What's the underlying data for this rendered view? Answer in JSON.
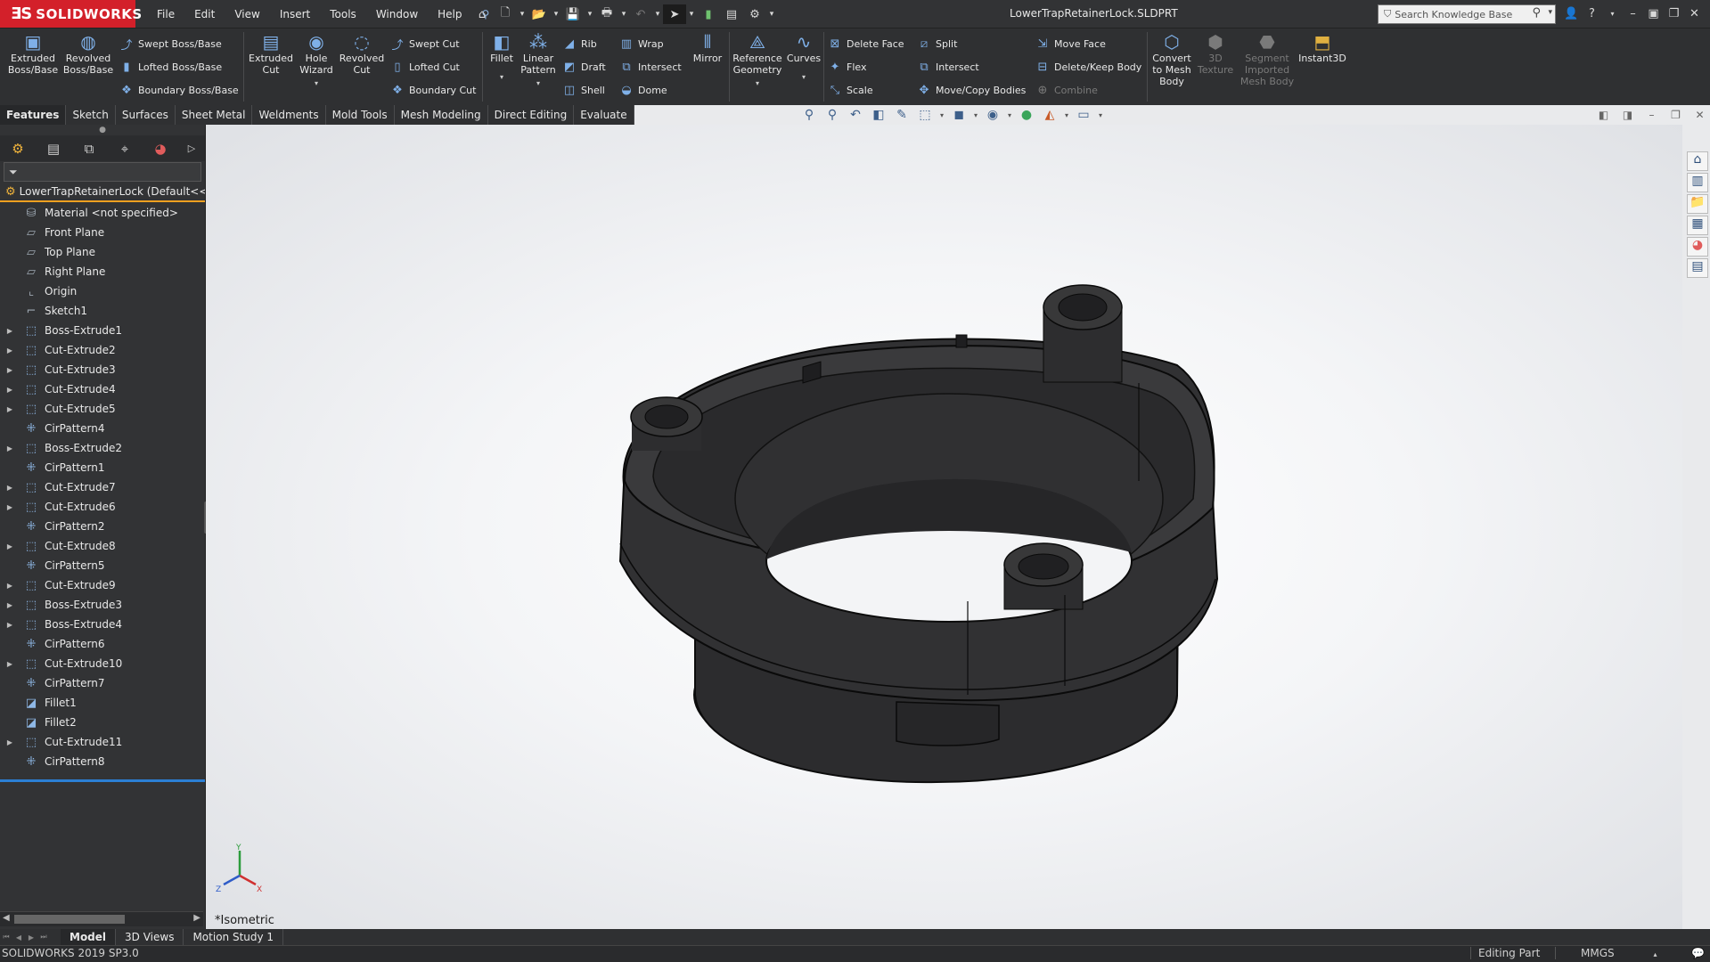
{
  "app": {
    "logo": "SOLIDWORKS",
    "document_title": "LowerTrapRetainerLock.SLDPRT"
  },
  "menus": [
    "File",
    "Edit",
    "View",
    "Insert",
    "Tools",
    "Window",
    "Help"
  ],
  "search": {
    "placeholder": "Search Knowledge Base"
  },
  "commands": {
    "extruded_boss": "Extruded\nBoss/Base",
    "revolved_boss": "Revolved\nBoss/Base",
    "swept_boss": "Swept Boss/Base",
    "lofted_boss": "Lofted Boss/Base",
    "boundary_boss": "Boundary Boss/Base",
    "extruded_cut": "Extruded\nCut",
    "hole_wizard": "Hole\nWizard",
    "revolved_cut": "Revolved\nCut",
    "swept_cut": "Swept Cut",
    "lofted_cut": "Lofted Cut",
    "boundary_cut": "Boundary Cut",
    "fillet": "Fillet",
    "linear_pattern": "Linear\nPattern",
    "rib": "Rib",
    "draft": "Draft",
    "shell": "Shell",
    "wrap": "Wrap",
    "intersect": "Intersect",
    "dome": "Dome",
    "mirror": "Mirror",
    "reference_geometry": "Reference\nGeometry",
    "curves": "Curves",
    "delete_face": "Delete Face",
    "flex": "Flex",
    "scale": "Scale",
    "split": "Split",
    "intersect2": "Intersect",
    "move_copy_bodies": "Move/Copy Bodies",
    "move_face": "Move Face",
    "delete_keep_body": "Delete/Keep Body",
    "combine": "Combine",
    "convert_mesh": "Convert\nto Mesh\nBody",
    "texture_3d": "3D\nTexture",
    "segment_mesh": "Segment\nImported\nMesh Body",
    "instant3d": "Instant3D"
  },
  "tabs": [
    "Features",
    "Sketch",
    "Surfaces",
    "Sheet Metal",
    "Weldments",
    "Mold Tools",
    "Mesh Modeling",
    "Direct Editing",
    "Evaluate"
  ],
  "tree": {
    "root": "LowerTrapRetainerLock  (Default<<De",
    "items": [
      {
        "label": "Material <not specified>",
        "expandable": false,
        "icon": "material-icon"
      },
      {
        "label": "Front Plane",
        "expandable": false,
        "icon": "plane-icon"
      },
      {
        "label": "Top Plane",
        "expandable": false,
        "icon": "plane-icon"
      },
      {
        "label": "Right Plane",
        "expandable": false,
        "icon": "plane-icon"
      },
      {
        "label": "Origin",
        "expandable": false,
        "icon": "origin-icon"
      },
      {
        "label": "Sketch1",
        "expandable": false,
        "icon": "sketch-icon"
      },
      {
        "label": "Boss-Extrude1",
        "expandable": true,
        "icon": "extrude-icon"
      },
      {
        "label": "Cut-Extrude2",
        "expandable": true,
        "icon": "cut-extrude-icon"
      },
      {
        "label": "Cut-Extrude3",
        "expandable": true,
        "icon": "cut-extrude-icon"
      },
      {
        "label": "Cut-Extrude4",
        "expandable": true,
        "icon": "cut-extrude-icon"
      },
      {
        "label": "Cut-Extrude5",
        "expandable": true,
        "icon": "cut-extrude-icon"
      },
      {
        "label": "CirPattern4",
        "expandable": false,
        "icon": "circular-pattern-icon"
      },
      {
        "label": "Boss-Extrude2",
        "expandable": true,
        "icon": "extrude-icon"
      },
      {
        "label": "CirPattern1",
        "expandable": false,
        "icon": "circular-pattern-icon"
      },
      {
        "label": "Cut-Extrude7",
        "expandable": true,
        "icon": "cut-extrude-icon"
      },
      {
        "label": "Cut-Extrude6",
        "expandable": true,
        "icon": "cut-extrude-icon"
      },
      {
        "label": "CirPattern2",
        "expandable": false,
        "icon": "circular-pattern-icon"
      },
      {
        "label": "Cut-Extrude8",
        "expandable": true,
        "icon": "cut-extrude-icon"
      },
      {
        "label": "CirPattern5",
        "expandable": false,
        "icon": "circular-pattern-icon"
      },
      {
        "label": "Cut-Extrude9",
        "expandable": true,
        "icon": "cut-extrude-icon"
      },
      {
        "label": "Boss-Extrude3",
        "expandable": true,
        "icon": "extrude-icon"
      },
      {
        "label": "Boss-Extrude4",
        "expandable": true,
        "icon": "extrude-icon"
      },
      {
        "label": "CirPattern6",
        "expandable": false,
        "icon": "circular-pattern-icon"
      },
      {
        "label": "Cut-Extrude10",
        "expandable": true,
        "icon": "cut-extrude-icon"
      },
      {
        "label": "CirPattern7",
        "expandable": false,
        "icon": "circular-pattern-icon"
      },
      {
        "label": "Fillet1",
        "expandable": false,
        "icon": "fillet-icon"
      },
      {
        "label": "Fillet2",
        "expandable": false,
        "icon": "fillet-icon"
      },
      {
        "label": "Cut-Extrude11",
        "expandable": true,
        "icon": "cut-extrude-icon"
      },
      {
        "label": "CirPattern8",
        "expandable": false,
        "icon": "circular-pattern-icon"
      }
    ]
  },
  "viewport": {
    "view_label": "*Isometric",
    "triad": {
      "x": "X",
      "y": "Y",
      "z": "Z"
    }
  },
  "bottom_tabs": [
    "Model",
    "3D Views",
    "Motion Study 1"
  ],
  "status": {
    "version": "SOLIDWORKS 2019 SP3.0",
    "mode": "Editing Part",
    "units": "MMGS"
  },
  "colors": {
    "brand": "#d3202a",
    "accent_orange": "#f0a020",
    "tree_end": "#2b7fd4",
    "model": "#2a2a2b"
  }
}
